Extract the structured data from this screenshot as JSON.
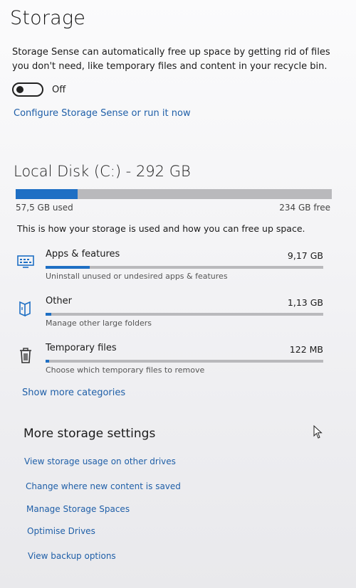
{
  "page": {
    "title": "Storage"
  },
  "storage_sense": {
    "description": "Storage Sense can automatically free up space by getting rid of files you don't need, like temporary files and content in your recycle bin.",
    "toggle_state": "Off",
    "toggle_on": false,
    "configure_link": "Configure Storage Sense or run it now"
  },
  "disk": {
    "title": "Local Disk (C:) - 292 GB",
    "used_label": "57,5 GB used",
    "free_label": "234 GB free",
    "used_fraction": 0.197,
    "usage_text": "This is how your storage is used and how you can free up space."
  },
  "categories": [
    {
      "name": "Apps & features",
      "size": "9,17 GB",
      "description": "Uninstall unused or undesired apps & features",
      "icon": "apps-features-icon",
      "fill_fraction": 0.16
    },
    {
      "name": "Other",
      "size": "1,13 GB",
      "description": "Manage other large folders",
      "icon": "other-folder-icon",
      "fill_fraction": 0.02
    },
    {
      "name": "Temporary files",
      "size": "122 MB",
      "description": "Choose which temporary files to remove",
      "icon": "trash-icon",
      "fill_fraction": 0.003
    }
  ],
  "show_more": "Show more categories",
  "more_settings": {
    "title": "More storage settings",
    "links": [
      "View storage usage on other drives",
      "Change where new content is saved",
      "Manage Storage Spaces",
      "Optimise Drives",
      "View backup options"
    ]
  },
  "colors": {
    "accent": "#1e6fc4",
    "link": "#1f5fa8",
    "bar_track": "#b9b9bc"
  }
}
